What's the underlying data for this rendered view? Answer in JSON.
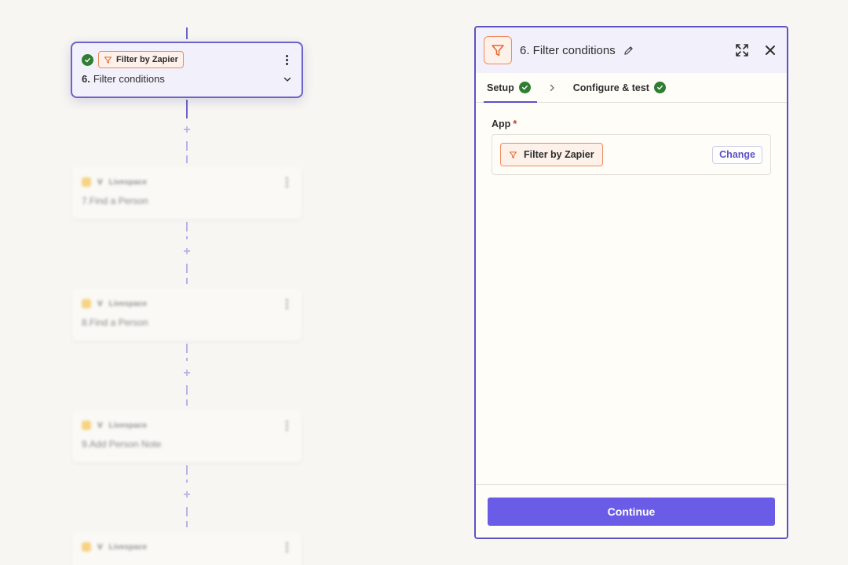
{
  "canvas": {
    "active_step": {
      "app_name": "Filter by Zapier",
      "number": "6.",
      "title": "Filter conditions"
    },
    "faded_steps": [
      {
        "app_name": "Livespace",
        "number": "7.",
        "title": "Find a Person"
      },
      {
        "app_name": "Livespace",
        "number": "8.",
        "title": "Find a Person"
      },
      {
        "app_name": "Livespace",
        "number": "9.",
        "title": "Add Person Note"
      },
      {
        "app_name": "Livespace",
        "number": "",
        "title": ""
      }
    ]
  },
  "panel": {
    "title": "6. Filter conditions",
    "tabs": [
      {
        "label": "Setup",
        "status": "complete"
      },
      {
        "label": "Configure & test",
        "status": "complete"
      }
    ],
    "app_field": {
      "label": "App",
      "required_mark": "*",
      "value": "Filter by Zapier",
      "change_label": "Change"
    },
    "continue_label": "Continue"
  },
  "colors": {
    "accent": "#6b63c9",
    "button": "#6b5ce7",
    "filter_orange": "#f08a5d",
    "success": "#2e7d32"
  }
}
